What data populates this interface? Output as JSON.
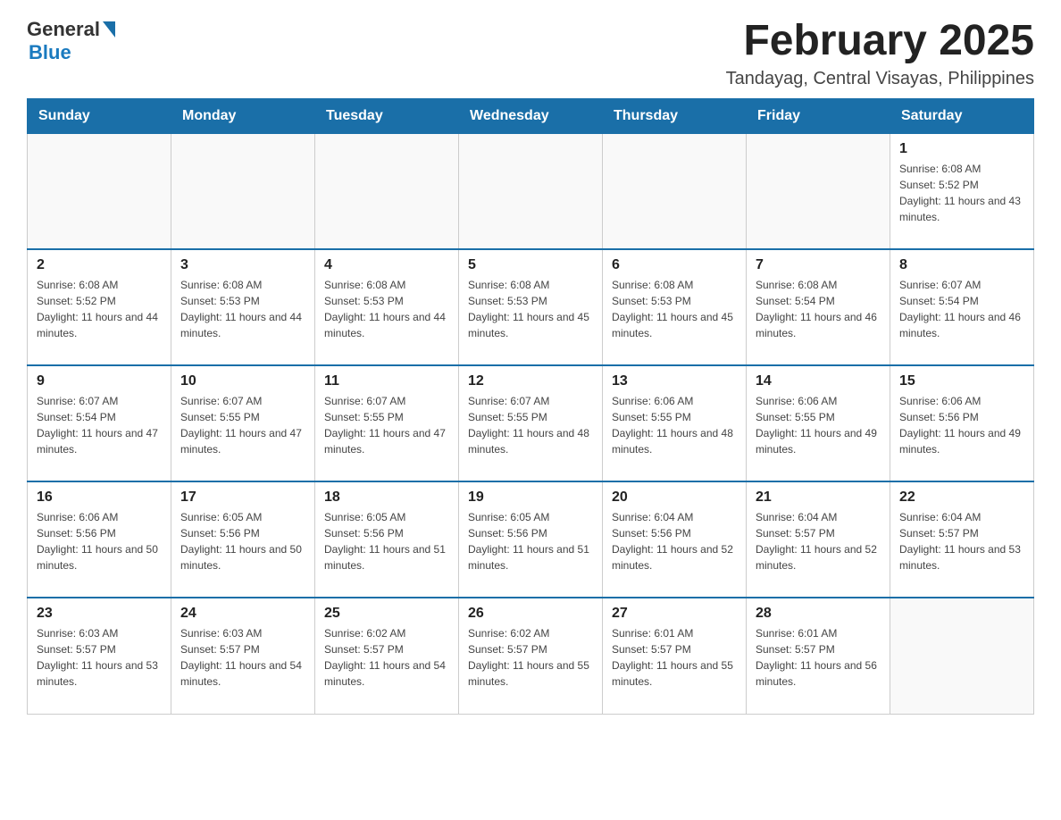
{
  "header": {
    "logo_general": "General",
    "logo_blue": "Blue",
    "title": "February 2025",
    "subtitle": "Tandayag, Central Visayas, Philippines"
  },
  "weekdays": [
    "Sunday",
    "Monday",
    "Tuesday",
    "Wednesday",
    "Thursday",
    "Friday",
    "Saturday"
  ],
  "weeks": [
    [
      {
        "day": "",
        "info": ""
      },
      {
        "day": "",
        "info": ""
      },
      {
        "day": "",
        "info": ""
      },
      {
        "day": "",
        "info": ""
      },
      {
        "day": "",
        "info": ""
      },
      {
        "day": "",
        "info": ""
      },
      {
        "day": "1",
        "info": "Sunrise: 6:08 AM\nSunset: 5:52 PM\nDaylight: 11 hours and 43 minutes."
      }
    ],
    [
      {
        "day": "2",
        "info": "Sunrise: 6:08 AM\nSunset: 5:52 PM\nDaylight: 11 hours and 44 minutes."
      },
      {
        "day": "3",
        "info": "Sunrise: 6:08 AM\nSunset: 5:53 PM\nDaylight: 11 hours and 44 minutes."
      },
      {
        "day": "4",
        "info": "Sunrise: 6:08 AM\nSunset: 5:53 PM\nDaylight: 11 hours and 44 minutes."
      },
      {
        "day": "5",
        "info": "Sunrise: 6:08 AM\nSunset: 5:53 PM\nDaylight: 11 hours and 45 minutes."
      },
      {
        "day": "6",
        "info": "Sunrise: 6:08 AM\nSunset: 5:53 PM\nDaylight: 11 hours and 45 minutes."
      },
      {
        "day": "7",
        "info": "Sunrise: 6:08 AM\nSunset: 5:54 PM\nDaylight: 11 hours and 46 minutes."
      },
      {
        "day": "8",
        "info": "Sunrise: 6:07 AM\nSunset: 5:54 PM\nDaylight: 11 hours and 46 minutes."
      }
    ],
    [
      {
        "day": "9",
        "info": "Sunrise: 6:07 AM\nSunset: 5:54 PM\nDaylight: 11 hours and 47 minutes."
      },
      {
        "day": "10",
        "info": "Sunrise: 6:07 AM\nSunset: 5:55 PM\nDaylight: 11 hours and 47 minutes."
      },
      {
        "day": "11",
        "info": "Sunrise: 6:07 AM\nSunset: 5:55 PM\nDaylight: 11 hours and 47 minutes."
      },
      {
        "day": "12",
        "info": "Sunrise: 6:07 AM\nSunset: 5:55 PM\nDaylight: 11 hours and 48 minutes."
      },
      {
        "day": "13",
        "info": "Sunrise: 6:06 AM\nSunset: 5:55 PM\nDaylight: 11 hours and 48 minutes."
      },
      {
        "day": "14",
        "info": "Sunrise: 6:06 AM\nSunset: 5:55 PM\nDaylight: 11 hours and 49 minutes."
      },
      {
        "day": "15",
        "info": "Sunrise: 6:06 AM\nSunset: 5:56 PM\nDaylight: 11 hours and 49 minutes."
      }
    ],
    [
      {
        "day": "16",
        "info": "Sunrise: 6:06 AM\nSunset: 5:56 PM\nDaylight: 11 hours and 50 minutes."
      },
      {
        "day": "17",
        "info": "Sunrise: 6:05 AM\nSunset: 5:56 PM\nDaylight: 11 hours and 50 minutes."
      },
      {
        "day": "18",
        "info": "Sunrise: 6:05 AM\nSunset: 5:56 PM\nDaylight: 11 hours and 51 minutes."
      },
      {
        "day": "19",
        "info": "Sunrise: 6:05 AM\nSunset: 5:56 PM\nDaylight: 11 hours and 51 minutes."
      },
      {
        "day": "20",
        "info": "Sunrise: 6:04 AM\nSunset: 5:56 PM\nDaylight: 11 hours and 52 minutes."
      },
      {
        "day": "21",
        "info": "Sunrise: 6:04 AM\nSunset: 5:57 PM\nDaylight: 11 hours and 52 minutes."
      },
      {
        "day": "22",
        "info": "Sunrise: 6:04 AM\nSunset: 5:57 PM\nDaylight: 11 hours and 53 minutes."
      }
    ],
    [
      {
        "day": "23",
        "info": "Sunrise: 6:03 AM\nSunset: 5:57 PM\nDaylight: 11 hours and 53 minutes."
      },
      {
        "day": "24",
        "info": "Sunrise: 6:03 AM\nSunset: 5:57 PM\nDaylight: 11 hours and 54 minutes."
      },
      {
        "day": "25",
        "info": "Sunrise: 6:02 AM\nSunset: 5:57 PM\nDaylight: 11 hours and 54 minutes."
      },
      {
        "day": "26",
        "info": "Sunrise: 6:02 AM\nSunset: 5:57 PM\nDaylight: 11 hours and 55 minutes."
      },
      {
        "day": "27",
        "info": "Sunrise: 6:01 AM\nSunset: 5:57 PM\nDaylight: 11 hours and 55 minutes."
      },
      {
        "day": "28",
        "info": "Sunrise: 6:01 AM\nSunset: 5:57 PM\nDaylight: 11 hours and 56 minutes."
      },
      {
        "day": "",
        "info": ""
      }
    ]
  ]
}
